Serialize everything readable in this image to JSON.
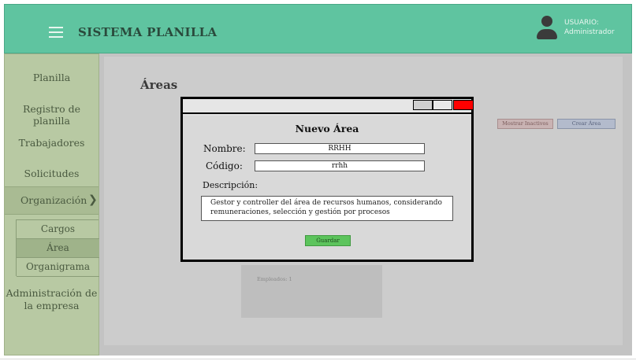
{
  "header": {
    "title": "SISTEMA PLANILLA",
    "user_label": "USUARIO:",
    "user_name": "Administrador"
  },
  "sidebar": {
    "items": [
      {
        "label": "Planilla"
      },
      {
        "label": "Registro de planilla"
      },
      {
        "label": "Trabajadores"
      },
      {
        "label": "Solicitudes"
      },
      {
        "label": "Organización"
      },
      {
        "label": "Administración de"
      },
      {
        "label": "la empresa"
      }
    ],
    "org_chevron": "❯",
    "subitems": [
      {
        "label": "Cargos"
      },
      {
        "label": "Área",
        "active": true
      },
      {
        "label": "Organigrama"
      }
    ]
  },
  "main": {
    "title": "Áreas",
    "show_inactive_label": "Mostrar Inactivos",
    "create_label": "Crear Área",
    "card_text": "Empleados: 1"
  },
  "modal": {
    "heading": "Nuevo Área",
    "name_label": "Nombre:",
    "name_value": "RRHH",
    "code_label": "Código:",
    "code_value": "rrhh",
    "desc_label": "Descripción:",
    "desc_line1": "Gestor y controller del área de recursos humanos, considerando",
    "desc_line2": "remuneraciones, selección y gestión por procesos",
    "save_label": "Guardar"
  },
  "colors": {
    "header_bg": "#5fc4a0",
    "sidebar_bg": "#b8c9a3",
    "close_btn": "#ff0000",
    "save_btn": "#5cc45c"
  }
}
